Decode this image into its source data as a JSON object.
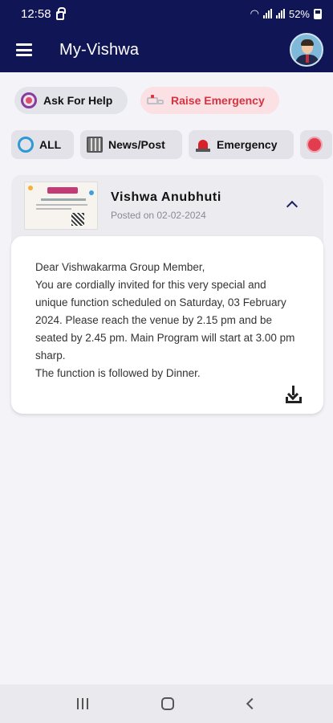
{
  "status_bar": {
    "time": "12:58",
    "battery": "52%",
    "icons": [
      "lock-icon",
      "wifi-icon",
      "volte-icon",
      "signal-icon",
      "battery-icon"
    ]
  },
  "app_bar": {
    "title": "My-Vishwa",
    "menu_icon": "menu-icon",
    "avatar_icon": "avatar"
  },
  "actions": {
    "help_label": "Ask For Help",
    "emergency_label": "Raise Emergency",
    "emergency_color": "#d63340"
  },
  "filters": [
    {
      "label": "ALL",
      "icon": "all-icon"
    },
    {
      "label": "News/Post",
      "icon": "news-icon"
    },
    {
      "label": "Emergency",
      "icon": "alarm-icon"
    },
    {
      "label": "",
      "icon": "more-category-icon"
    }
  ],
  "post": {
    "title": "Vishwa Anubhuti",
    "posted_on": "Posted on 02-02-2024",
    "message": "Dear Vishwakarma Group Member,\nYou are cordially invited for this very special and unique function scheduled on Saturday, 03 February 2024. Please reach the venue by 2.15 pm and be seated by 2.45 pm.  Main Program will start at 3.00 pm sharp.\nThe function is followed by Dinner.",
    "expanded": true
  },
  "theme": {
    "primary": "#101556",
    "background": "#f4f4f8"
  }
}
